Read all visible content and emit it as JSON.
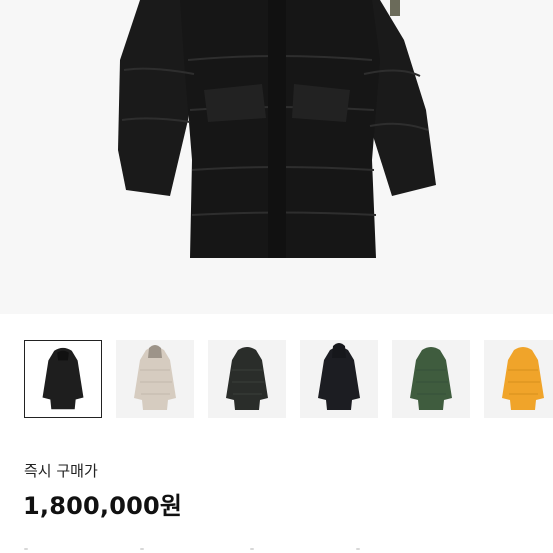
{
  "product": {
    "main_image": "black-long-parka-photo",
    "thumbnails": [
      {
        "name": "black-parka",
        "color": "#1e1e1e",
        "selected": true
      },
      {
        "name": "beige-parka",
        "color": "#d6ccc0",
        "selected": false
      },
      {
        "name": "dark-green-black-parka",
        "color": "#2a2d2a",
        "selected": false
      },
      {
        "name": "navy-black-parka",
        "color": "#1c1d22",
        "selected": false
      },
      {
        "name": "green-parka",
        "color": "#3f5c3e",
        "selected": false
      },
      {
        "name": "orange-parka",
        "color": "#f0a42a",
        "selected": false
      }
    ]
  },
  "purchase": {
    "label": "즉시 구매가",
    "price": "1,800,000원"
  }
}
